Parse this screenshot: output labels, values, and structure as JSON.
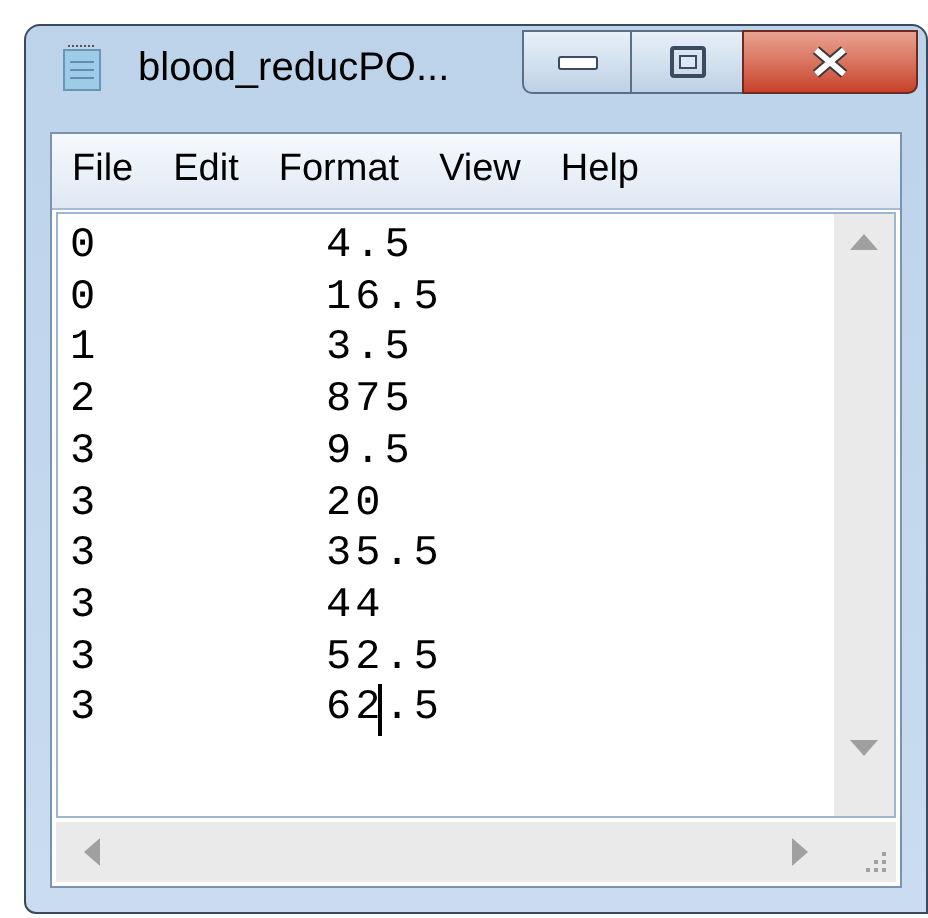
{
  "window": {
    "title": "blood_reducPO..."
  },
  "menu": [
    {
      "label": "File"
    },
    {
      "label": "Edit"
    },
    {
      "label": "Format"
    },
    {
      "label": "View"
    },
    {
      "label": "Help"
    }
  ],
  "lines": [
    {
      "column_1": "0",
      "column_2": "4.5",
      "caret": false
    },
    {
      "column_1": "0",
      "column_2": "16.5",
      "caret": false
    },
    {
      "column_1": "1",
      "column_2": "3.5",
      "caret": false
    },
    {
      "column_1": "2",
      "column_2": "875",
      "caret": false
    },
    {
      "column_1": "3",
      "column_2": "9.5",
      "caret": false
    },
    {
      "column_1": "3",
      "column_2": "20",
      "caret": false
    },
    {
      "column_1": "3",
      "column_2": "35.5",
      "caret": false
    },
    {
      "column_1": "3",
      "column_2": "44",
      "caret": false
    },
    {
      "column_1": "3",
      "column_2": "52.5",
      "caret": false
    },
    {
      "column_1": "3",
      "column_2": "62",
      "caret": true,
      "column_2_after_caret": ".5"
    }
  ]
}
